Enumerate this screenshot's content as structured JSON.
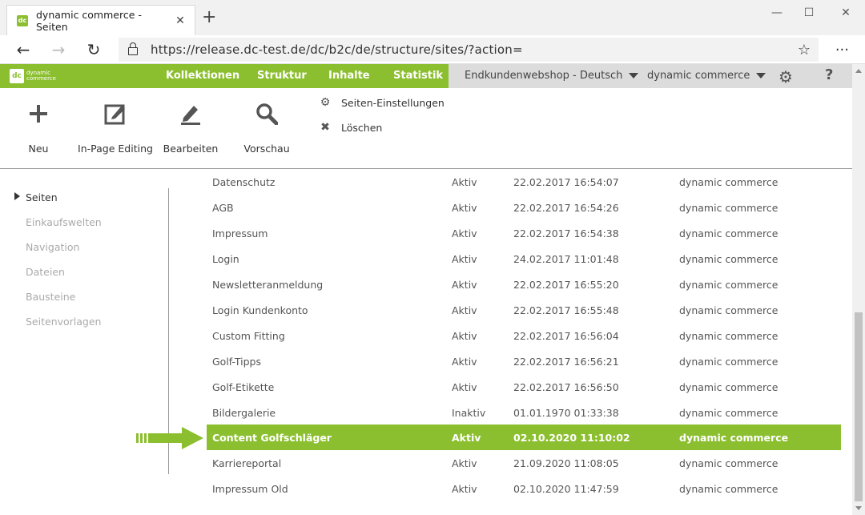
{
  "browser": {
    "tab_title": "dynamic commerce - Seiten",
    "tab_close": "✕",
    "new_tab": "+",
    "url": "https://release.dc-test.de/dc/b2c/de/structure/sites/?action=",
    "minimize": "—",
    "maximize": "☐",
    "close": "✕",
    "back": "←",
    "forward": "→",
    "reload": "↻",
    "favorite": "☆",
    "more": "···"
  },
  "app": {
    "logo_line1": "dynamic",
    "logo_line2": "commerce",
    "nav": [
      "Kollektionen",
      "Struktur",
      "Inhalte",
      "Statistik"
    ],
    "shop_select": "Endkundenwebshop - Deutsch",
    "user_select": "dynamic commerce",
    "help": "?"
  },
  "toolbar": {
    "new": "Neu",
    "inpage": "In-Page Editing",
    "edit": "Bearbeiten",
    "preview": "Vorschau",
    "settings": "Seiten-Einstellungen",
    "delete": "Löschen"
  },
  "sidebar": {
    "items": [
      "Seiten",
      "Einkaufswelten",
      "Navigation",
      "Dateien",
      "Bausteine",
      "Seitenvorlagen"
    ]
  },
  "rows": [
    {
      "name": "Datenschutz",
      "status": "Aktiv",
      "date": "22.02.2017 16:54:07",
      "author": "dynamic commerce"
    },
    {
      "name": "AGB",
      "status": "Aktiv",
      "date": "22.02.2017 16:54:26",
      "author": "dynamic commerce"
    },
    {
      "name": "Impressum",
      "status": "Aktiv",
      "date": "22.02.2017 16:54:38",
      "author": "dynamic commerce"
    },
    {
      "name": "Login",
      "status": "Aktiv",
      "date": "24.02.2017 11:01:48",
      "author": "dynamic commerce"
    },
    {
      "name": "Newsletteranmeldung",
      "status": "Aktiv",
      "date": "22.02.2017 16:55:20",
      "author": "dynamic commerce"
    },
    {
      "name": "Login Kundenkonto",
      "status": "Aktiv",
      "date": "22.02.2017 16:55:48",
      "author": "dynamic commerce"
    },
    {
      "name": "Custom Fitting",
      "status": "Aktiv",
      "date": "22.02.2017 16:56:04",
      "author": "dynamic commerce"
    },
    {
      "name": "Golf-Tipps",
      "status": "Aktiv",
      "date": "22.02.2017 16:56:21",
      "author": "dynamic commerce"
    },
    {
      "name": "Golf-Etikette",
      "status": "Aktiv",
      "date": "22.02.2017 16:56:50",
      "author": "dynamic commerce"
    },
    {
      "name": "Bildergalerie",
      "status": "Inaktiv",
      "date": "01.01.1970 01:33:38",
      "author": "dynamic commerce"
    },
    {
      "name": "Content Golfschläger",
      "status": "Aktiv",
      "date": "02.10.2020 11:10:02",
      "author": "dynamic commerce"
    },
    {
      "name": "Karriereportal",
      "status": "Aktiv",
      "date": "21.09.2020 11:08:05",
      "author": "dynamic commerce"
    },
    {
      "name": "Impressum Old",
      "status": "Aktiv",
      "date": "02.10.2020 11:47:59",
      "author": "dynamic commerce"
    }
  ],
  "colors": {
    "accent": "#8cbf2f",
    "selected_row": "#8cbf2f"
  }
}
